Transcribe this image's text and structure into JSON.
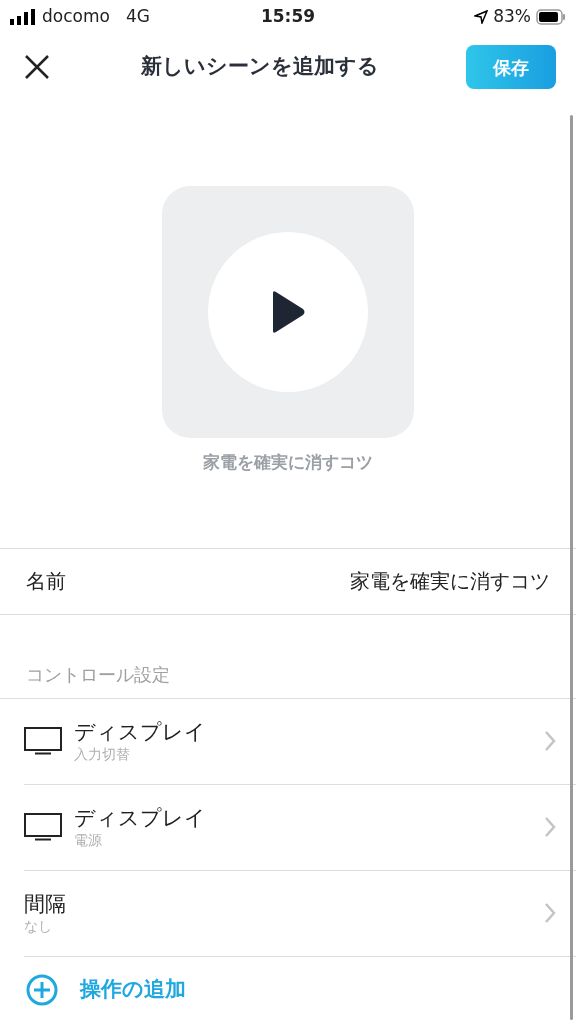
{
  "status_bar": {
    "carrier": "docomo",
    "network": "4G",
    "time": "15:59",
    "battery": "83%"
  },
  "header": {
    "title": "新しいシーンを追加する",
    "save": "保存"
  },
  "scene": {
    "caption": "家電を確実に消すコツ"
  },
  "name_row": {
    "label": "名前",
    "value": "家電を確実に消すコツ"
  },
  "section": {
    "label": "コントロール設定"
  },
  "controls": [
    {
      "kind": "device",
      "title": "ディスプレイ",
      "subtitle": "入力切替"
    },
    {
      "kind": "device",
      "title": "ディスプレイ",
      "subtitle": "電源"
    },
    {
      "kind": "interval",
      "title": "間隔",
      "subtitle": "なし"
    }
  ],
  "add_action": {
    "label": "操作の追加"
  }
}
